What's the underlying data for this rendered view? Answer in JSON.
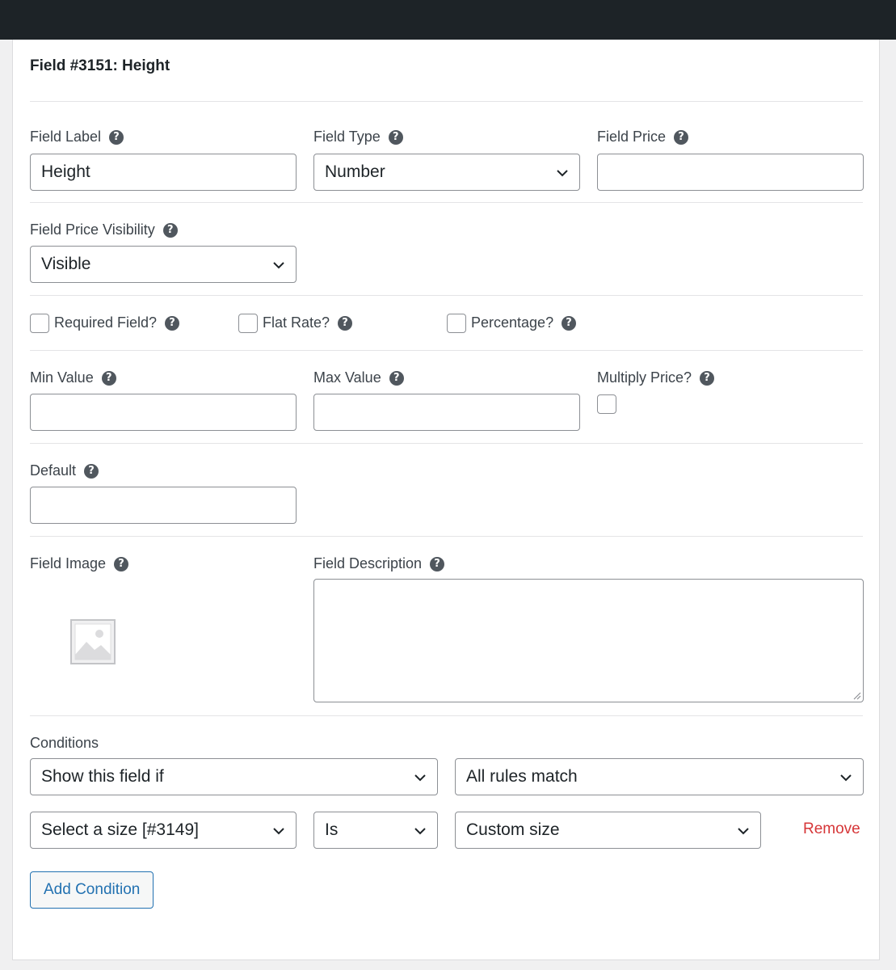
{
  "field_heading": "Field #3151: Height",
  "labels": {
    "field_label": "Field Label",
    "field_type": "Field Type",
    "field_price": "Field Price",
    "price_visibility": "Field Price Visibility",
    "min_value": "Min Value",
    "max_value": "Max Value",
    "multiply_price": "Multiply Price?",
    "default": "Default",
    "field_image": "Field Image",
    "field_description": "Field Description",
    "conditions": "Conditions"
  },
  "values": {
    "field_label": "Height",
    "field_type": "Number",
    "field_price": "",
    "price_visibility": "Visible",
    "min_value": "",
    "max_value": "",
    "default": "",
    "field_description": ""
  },
  "checkboxes": {
    "required": {
      "label": "Required Field?",
      "checked": false
    },
    "flat_rate": {
      "label": "Flat Rate?",
      "checked": false
    },
    "percentage": {
      "label": "Percentage?",
      "checked": false
    },
    "multiply_price": {
      "checked": false
    }
  },
  "conditions": {
    "mode": "Show this field if",
    "match": "All rules match",
    "rule": {
      "field": "Select a size [#3149]",
      "operator": "Is",
      "value": "Custom size",
      "remove_label": "Remove"
    },
    "add_label": "Add Condition"
  },
  "icons": {
    "help": "help-circle-icon",
    "chevron": "chevron-down-icon",
    "image_placeholder": "image-placeholder-icon"
  },
  "colors": {
    "topbar": "#1d2327",
    "accent": "#2271b1",
    "danger": "#d63638"
  }
}
